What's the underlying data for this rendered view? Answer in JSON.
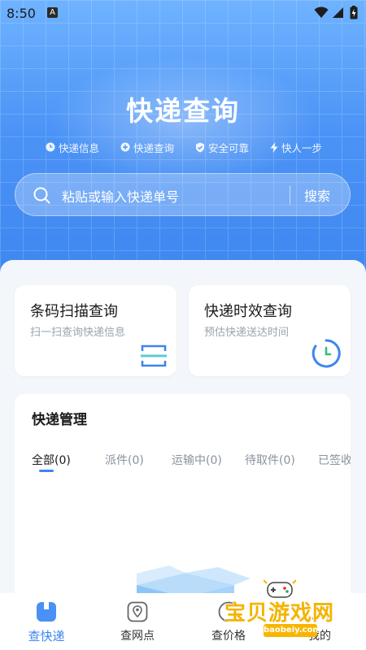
{
  "status_bar": {
    "time": "8:50",
    "notification_letter": "A"
  },
  "header": {
    "title": "快递查询",
    "features": [
      {
        "label": "快递信息",
        "icon": "clock-icon"
      },
      {
        "label": "快递查询",
        "icon": "plus-circle-icon"
      },
      {
        "label": "安全可靠",
        "icon": "shield-check-icon"
      },
      {
        "label": "快人一步",
        "icon": "lightning-icon"
      }
    ]
  },
  "search": {
    "placeholder": "粘贴或输入快递单号",
    "button_label": "搜索"
  },
  "cards": [
    {
      "title": "条码扫描查询",
      "subtitle": "扫一扫查询快递信息",
      "icon": "scan-icon"
    },
    {
      "title": "快递时效查询",
      "subtitle": "预估快递送达时间",
      "icon": "timer-icon"
    }
  ],
  "management": {
    "title": "快递管理",
    "tabs": [
      "全部(0)",
      "派件(0)",
      "运输中(0)",
      "待取件(0)",
      "已签收"
    ],
    "active_tab": 0
  },
  "bottom_nav": [
    {
      "label": "查快递",
      "icon": "package-icon",
      "active": true
    },
    {
      "label": "查网点",
      "icon": "location-pin-icon",
      "active": false
    },
    {
      "label": "查价格",
      "icon": "price-icon",
      "active": false
    },
    {
      "label": "我的",
      "icon": "user-icon",
      "active": false
    }
  ],
  "watermark": {
    "text": "宝贝游戏网",
    "url": "baobeiy.com"
  },
  "colors": {
    "accent": "#3c86f0",
    "hero_top": "#6fb3ff",
    "hero_bottom": "#3d86f0",
    "watermark": "#f4b400"
  }
}
